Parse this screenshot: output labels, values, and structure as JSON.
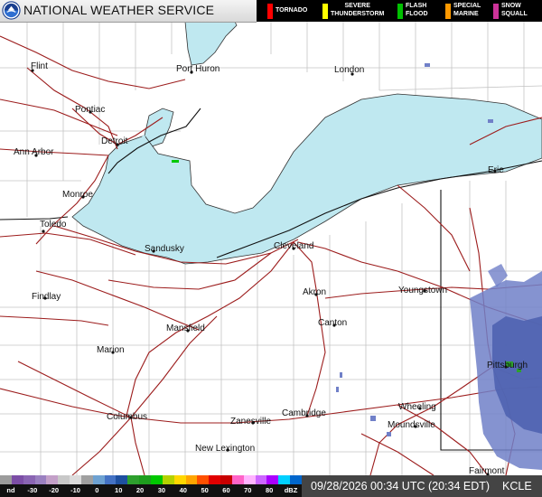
{
  "header": {
    "title": "NATIONAL WEATHER SERVICE",
    "logo_icon": "noaa-logo-icon"
  },
  "legend": [
    {
      "id": "tornado",
      "label": "TORNADO",
      "color": "#ff0000"
    },
    {
      "id": "severe-thunderstorm",
      "label": "SEVERE THUNDERSTORM",
      "line1": "SEVERE",
      "line2": "THUNDERSTORM",
      "color": "#ffff00"
    },
    {
      "id": "flash-flood",
      "label": "FLASH FLOOD",
      "line1": "FLASH",
      "line2": "FLOOD",
      "color": "#00c000"
    },
    {
      "id": "special-marine",
      "label": "SPECIAL MARINE",
      "line1": "SPECIAL",
      "line2": "MARINE",
      "color": "#ff9900"
    },
    {
      "id": "snow-squall",
      "label": "SNOW SQUALL",
      "line1": "SNOW",
      "line2": "SQUALL",
      "color": "#cc3399"
    }
  ],
  "cities": [
    {
      "name": "Flint"
    },
    {
      "name": "Port Huron"
    },
    {
      "name": "London"
    },
    {
      "name": "Pontiac"
    },
    {
      "name": "Detroit"
    },
    {
      "name": "Ann Arbor"
    },
    {
      "name": "Monroe"
    },
    {
      "name": "Toledo"
    },
    {
      "name": "Sandusky"
    },
    {
      "name": "Cleveland"
    },
    {
      "name": "Erie"
    },
    {
      "name": "Findlay"
    },
    {
      "name": "Akron"
    },
    {
      "name": "Youngstown"
    },
    {
      "name": "Canton"
    },
    {
      "name": "Mansfield"
    },
    {
      "name": "Marion"
    },
    {
      "name": "Pittsburgh"
    },
    {
      "name": "Columbus"
    },
    {
      "name": "Zanesville"
    },
    {
      "name": "Cambridge"
    },
    {
      "name": "Wheeling"
    },
    {
      "name": "Moundsville"
    },
    {
      "name": "New Lexington"
    },
    {
      "name": "Fairmont"
    }
  ],
  "dbz_scale": {
    "colors": [
      "#9c9c9c",
      "#7c4ea6",
      "#8a65b3",
      "#9a80c0",
      "#c3a0c8",
      "#c8c8c8",
      "#dcdcdc",
      "#a0a0a0",
      "#6ea2d2",
      "#4472c4",
      "#1e50a0",
      "#2ea02e",
      "#1e9e1e",
      "#00c800",
      "#b4d200",
      "#ffd700",
      "#ffa500",
      "#ff5000",
      "#e10000",
      "#c80000",
      "#ff64c8",
      "#ffb4ff",
      "#cc66ff",
      "#aa00ff",
      "#00d0ff",
      "#0066cc"
    ],
    "ticks": [
      "nd",
      "-30",
      "-20",
      "-10",
      "0",
      "10",
      "20",
      "30",
      "40",
      "50",
      "60",
      "70",
      "80",
      "dBZ"
    ]
  },
  "footer": {
    "timestamp": "09/28/2026 00:34 UTC (20:34 EDT)",
    "station": "KCLE"
  },
  "colors": {
    "water": "#bfe8f0",
    "land": "#ffffff",
    "highway": "#9c1c1c",
    "county_border": "#c4c4c4",
    "state_border": "#111111",
    "radar_light": "#7080c8",
    "radar_medium": "#4f63b0"
  }
}
